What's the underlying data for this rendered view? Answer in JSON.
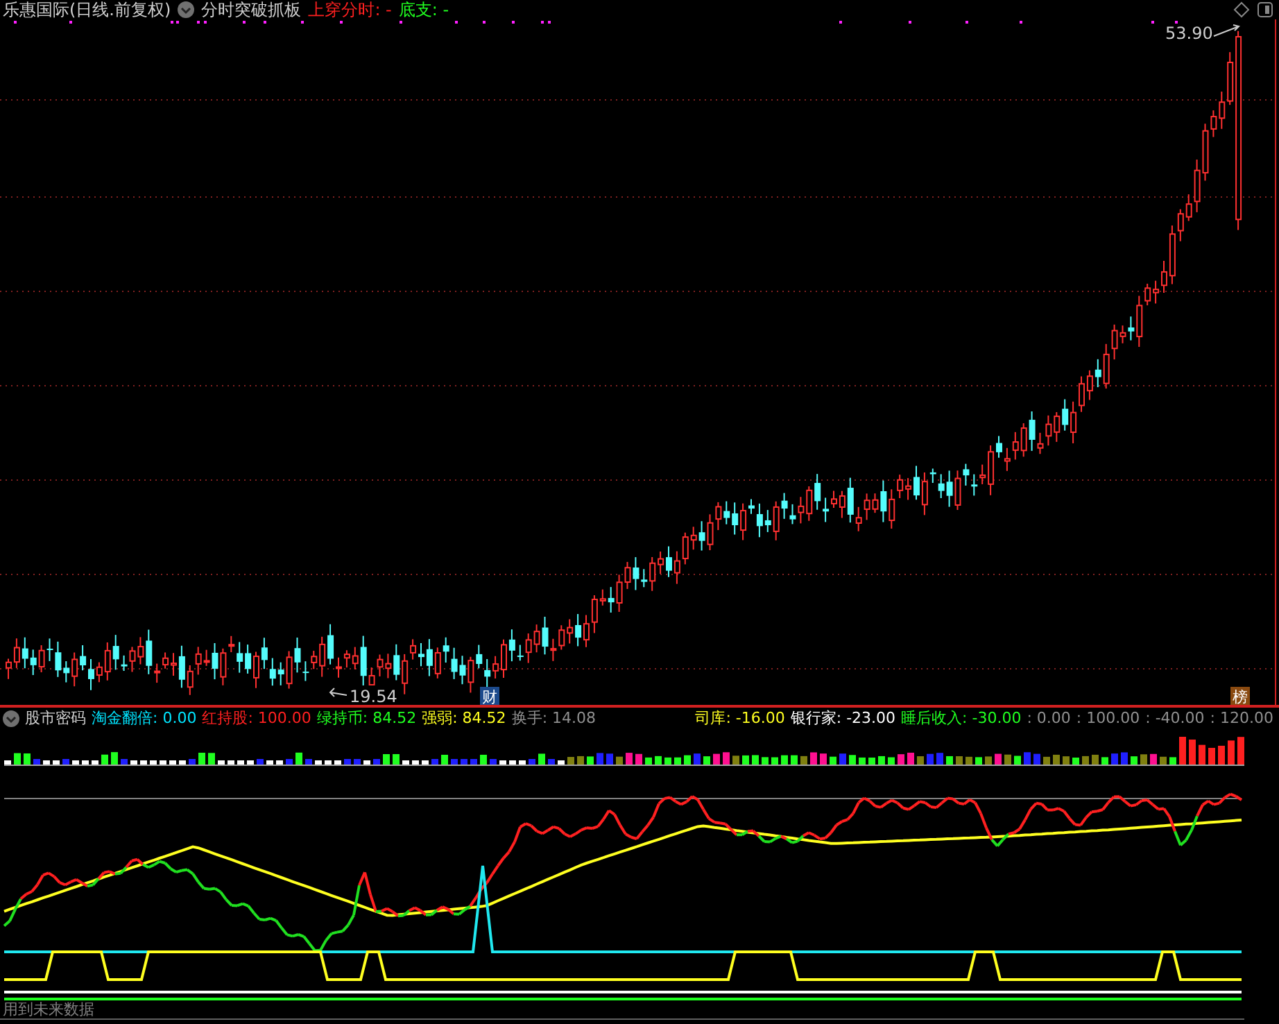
{
  "header": {
    "stock_title": "乐惠国际(日线.前复权)",
    "indicator_name": "分时突破抓板",
    "signals": [
      {
        "text": "上穿分时: -",
        "color": "#ff2020"
      },
      {
        "text": "底支: -",
        "color": "#20ff20"
      }
    ]
  },
  "price_chart": {
    "high_label": "53.90",
    "low_label": "19.54",
    "markers": [
      {
        "text": "财",
        "color": "#1c4a8c"
      },
      {
        "text": "榜",
        "color": "#8a4a10"
      }
    ]
  },
  "indicator_panel": {
    "title": "股市密码",
    "left_readouts": [
      {
        "text": "淘金翻倍: 0.00",
        "color": "#00e5ff"
      },
      {
        "text": "红持股: 100.00",
        "color": "#ff2020"
      },
      {
        "text": "绿持币: 84.52",
        "color": "#20ff20"
      },
      {
        "text": "强弱: 84.52",
        "color": "#ffff20"
      },
      {
        "text": "换手: 14.08",
        "color": "#909090"
      }
    ],
    "right_readouts": [
      {
        "text": "司库: -16.00",
        "color": "#ffff20"
      },
      {
        "text": "银行家: -23.00",
        "color": "#ffffff"
      },
      {
        "text": "睡后收入: -30.00",
        "color": "#20ff20"
      },
      {
        "text": ": 0.00",
        "color": "#909090"
      },
      {
        "text": ": 100.00",
        "color": "#909090"
      },
      {
        "text": ": -40.00",
        "color": "#909090"
      },
      {
        "text": ": 120.00",
        "color": "#909090"
      }
    ]
  },
  "footer_note": "用到未来数据"
}
